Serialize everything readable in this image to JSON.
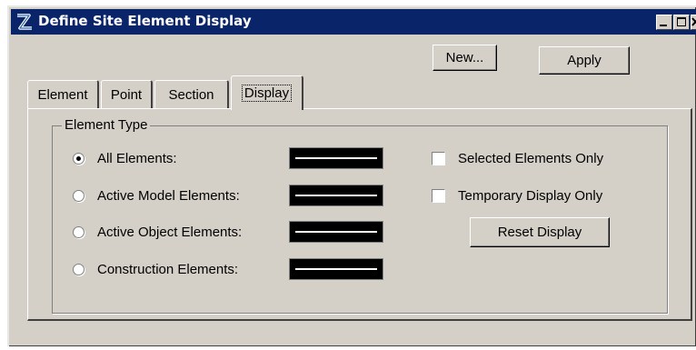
{
  "window": {
    "title": "Define Site Element Display",
    "icon": "app-logo-icon",
    "title_bar_color": "#0a246a",
    "face_color": "#d4d0c8"
  },
  "toolbar": {
    "new_label": "New...",
    "apply_label": "Apply"
  },
  "tabs": [
    {
      "label": "Element",
      "active": false
    },
    {
      "label": "Point",
      "active": false
    },
    {
      "label": "Section",
      "active": false
    },
    {
      "label": "Display",
      "active": true
    }
  ],
  "element_type": {
    "group_label": "Element Type",
    "options": [
      {
        "label": "All Elements:",
        "checked": true
      },
      {
        "label": "Active Model Elements:",
        "checked": false
      },
      {
        "label": "Active Object Elements:",
        "checked": false
      },
      {
        "label": "Construction Elements:",
        "checked": false
      }
    ]
  },
  "checkboxes": [
    {
      "label": "Selected Elements Only",
      "checked": false
    },
    {
      "label": "Temporary Display Only",
      "checked": false
    }
  ],
  "reset_label": "Reset Display"
}
